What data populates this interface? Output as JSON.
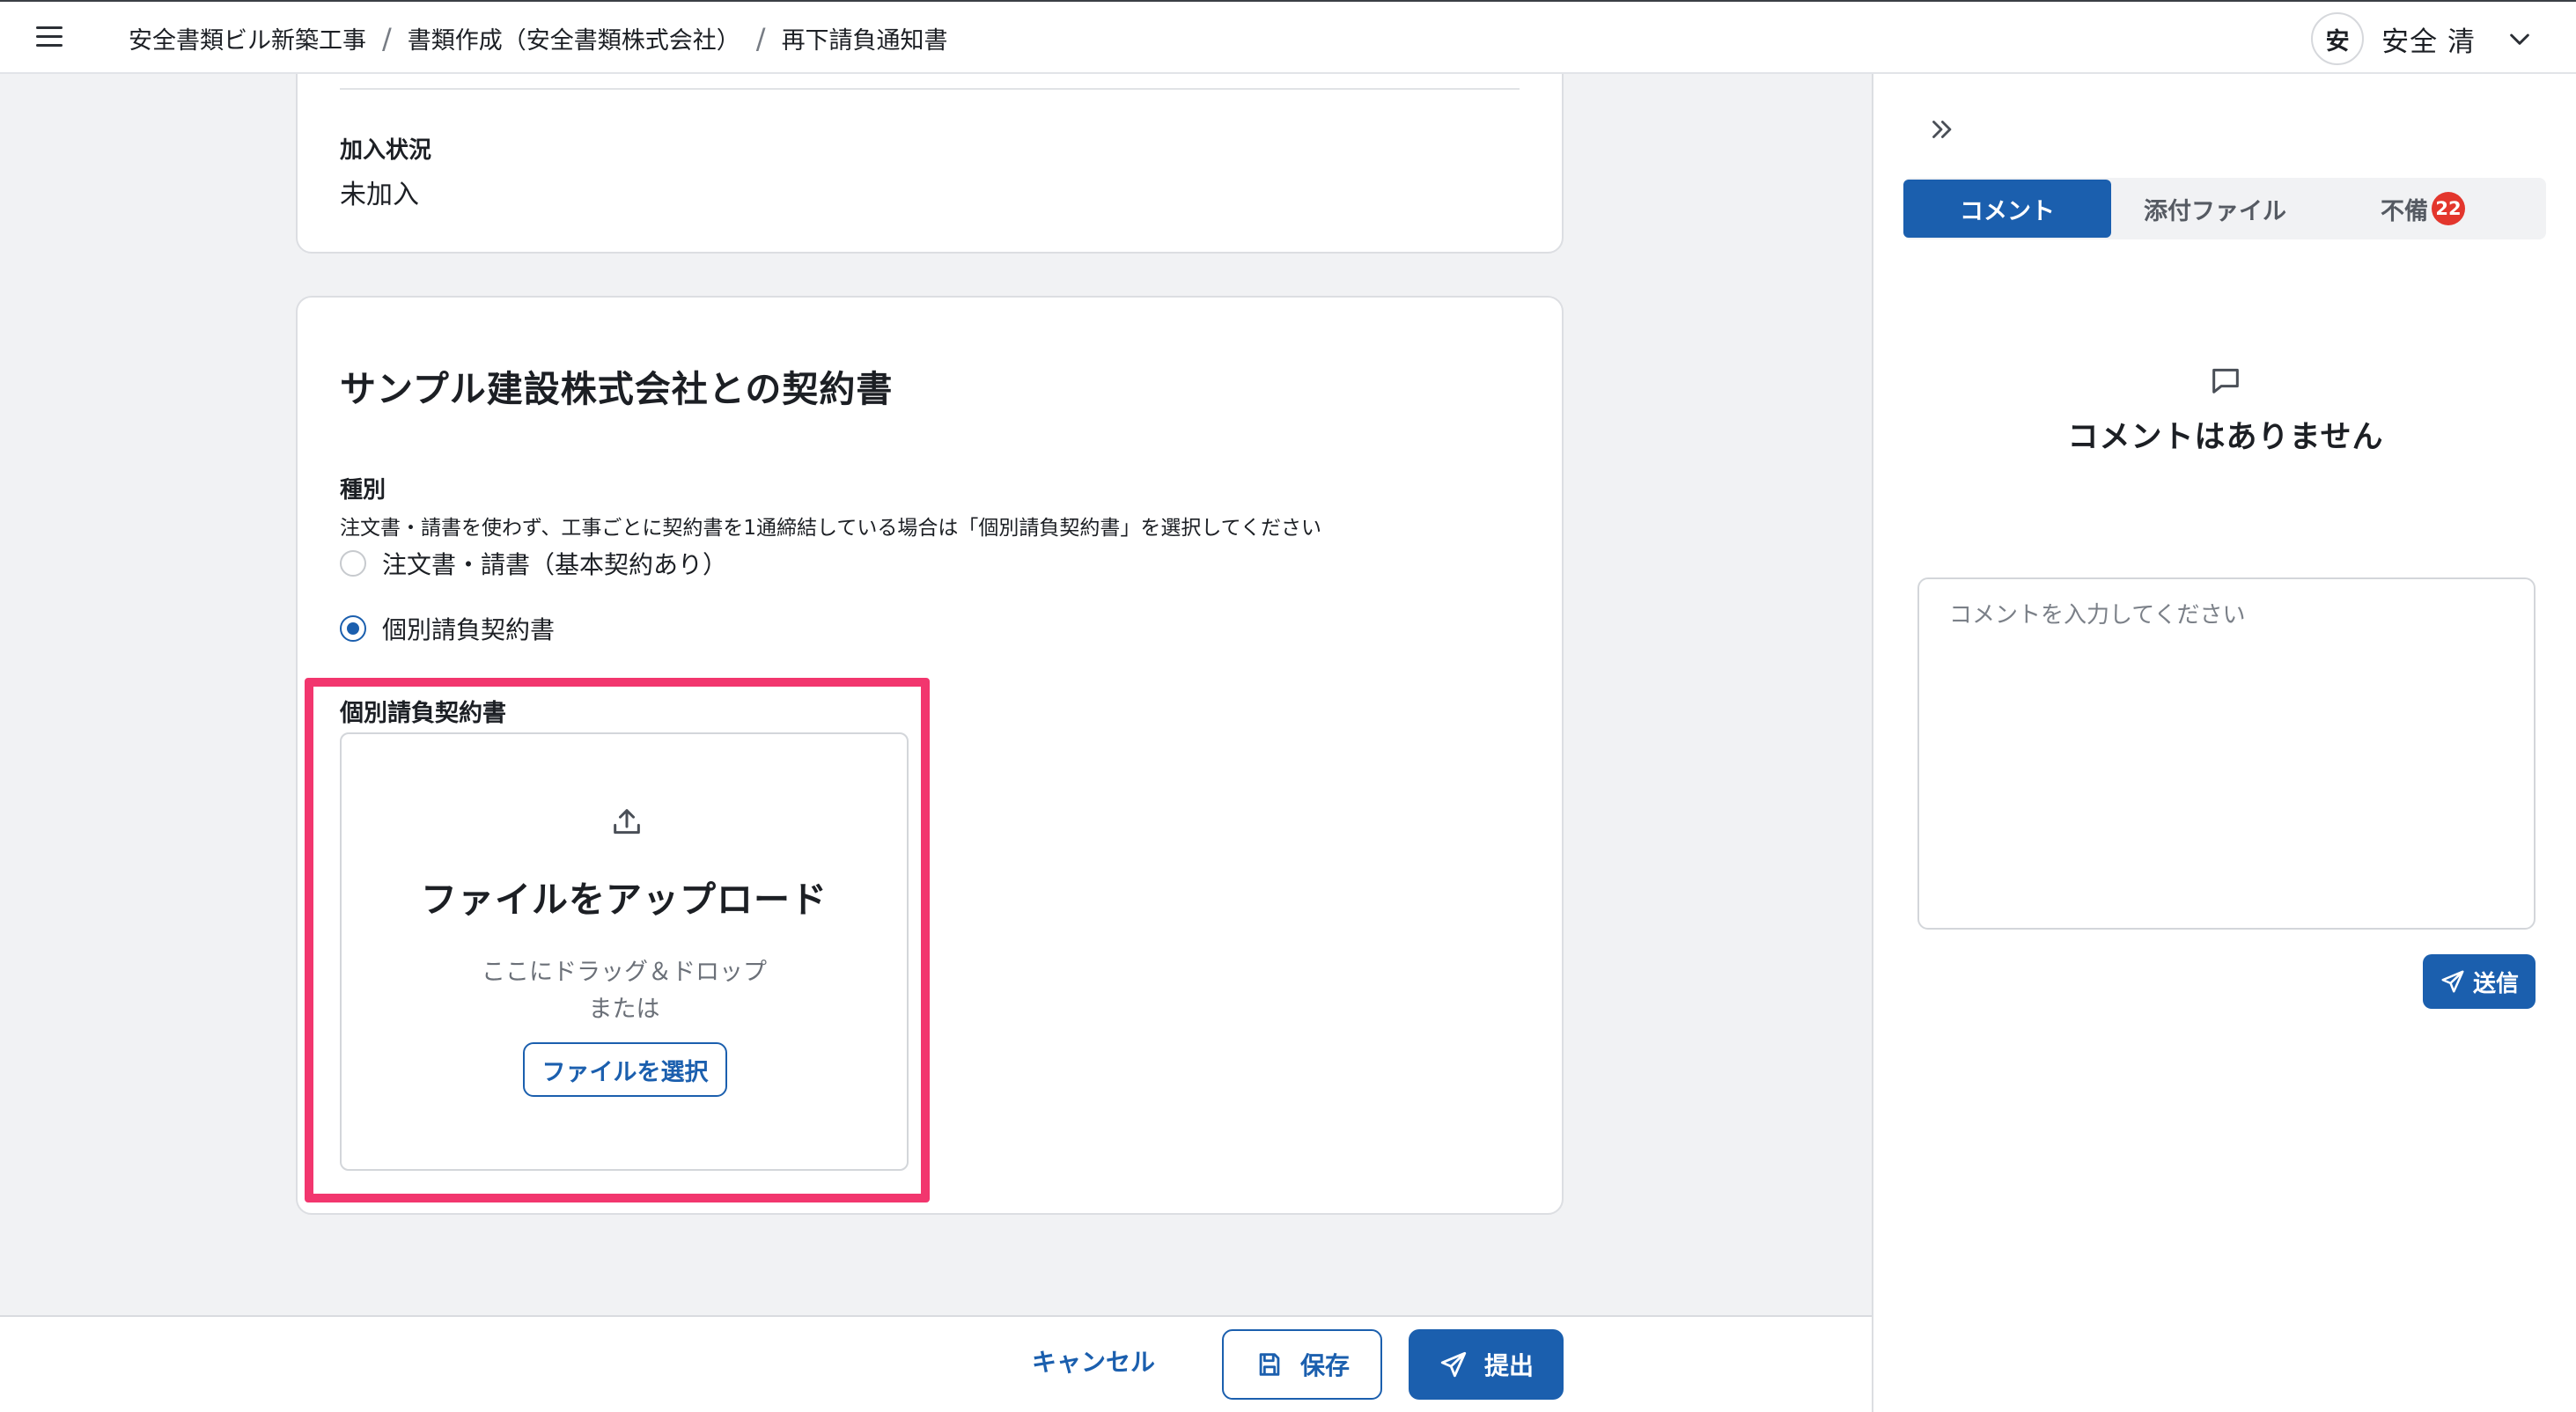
{
  "header": {
    "breadcrumb": [
      "安全書類ビル新築工事",
      "書類作成（安全書類株式会社）",
      "再下請負通知書"
    ],
    "user": {
      "avatar_text": "安",
      "name": "安全 清"
    }
  },
  "card_enrollment": {
    "label": "加入状況",
    "value": "未加入"
  },
  "contract_card": {
    "title": "サンプル建設株式会社との契約書",
    "type_label": "種別",
    "hint": "注文書・請書を使わず、工事ごとに契約書を1通締結している場合は「個別請負契約書」を選択してください",
    "options": [
      {
        "label": "注文書・請書（基本契約あり）",
        "selected": false
      },
      {
        "label": "個別請負契約書",
        "selected": true
      }
    ],
    "upload": {
      "label": "個別請負契約書",
      "title": "ファイルをアップロード",
      "drag_text": "ここにドラッグ＆ドロップ",
      "or_text": "または",
      "button_label": "ファイルを選択"
    }
  },
  "footer": {
    "cancel_label": "キャンセル",
    "save_label": "保存",
    "submit_label": "提出"
  },
  "side_panel": {
    "tabs": [
      {
        "label": "コメント",
        "active": true
      },
      {
        "label": "添付ファイル",
        "active": false
      },
      {
        "label": "不備",
        "active": false,
        "badge": "22"
      }
    ],
    "empty_text": "コメントはありません",
    "comment_placeholder": "コメントを入力してください",
    "send_label": "送信"
  },
  "colors": {
    "primary": "#1b5fae",
    "highlight": "#f2366e",
    "badge": "#e3362d",
    "background": "#f1f2f4"
  }
}
